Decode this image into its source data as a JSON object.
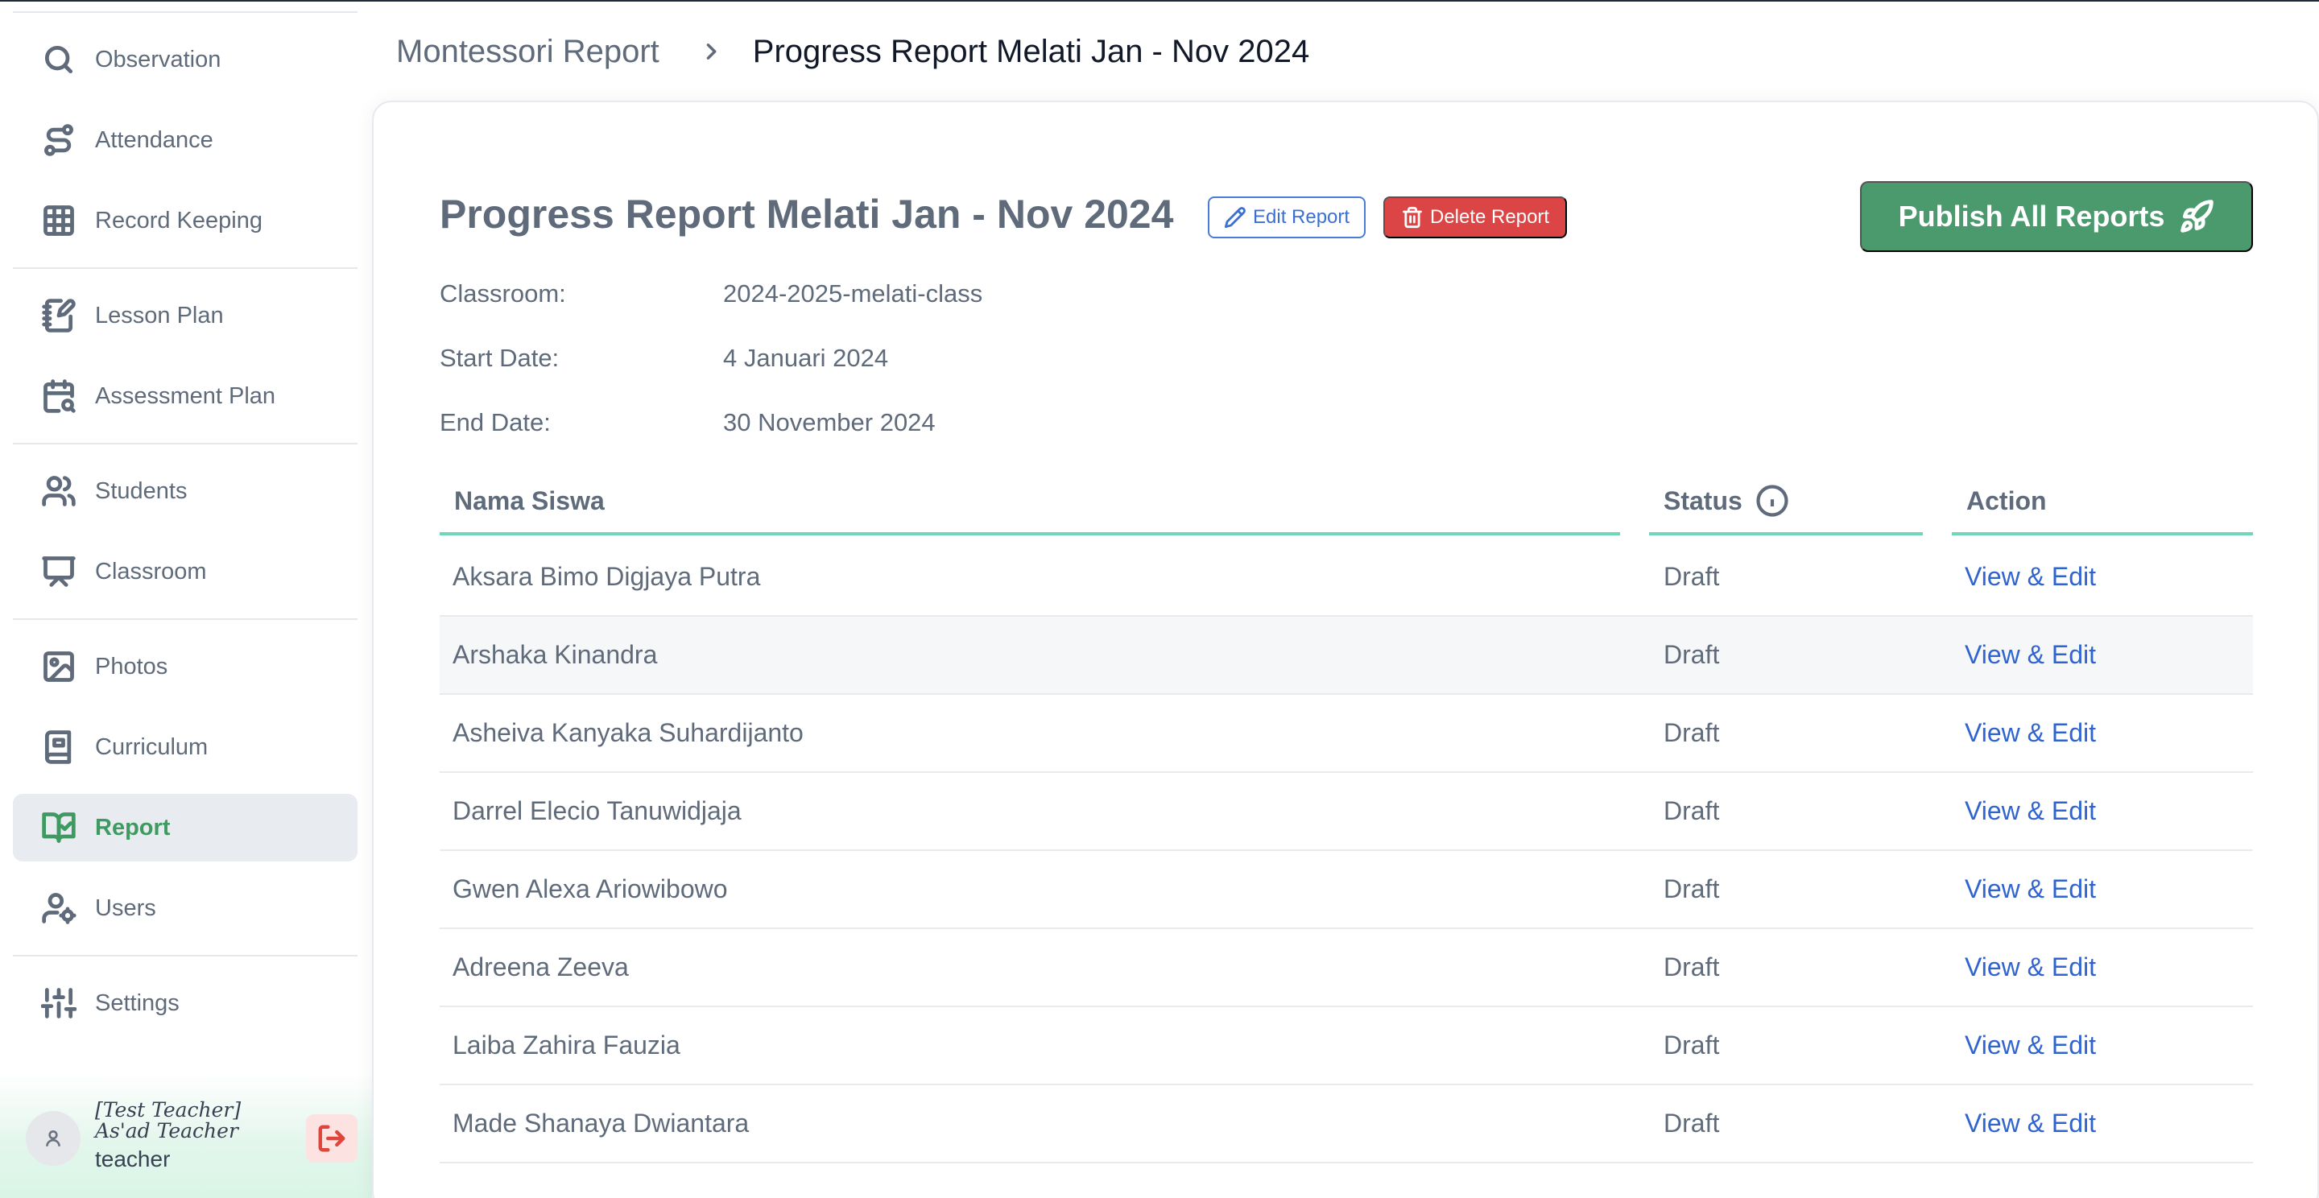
{
  "sidebar": {
    "items": [
      {
        "label": "Observation",
        "icon": "search-icon"
      },
      {
        "label": "Attendance",
        "icon": "route-icon"
      },
      {
        "label": "Record Keeping",
        "icon": "grid-icon"
      },
      {
        "label": "Lesson Plan",
        "icon": "notebook-pen-icon"
      },
      {
        "label": "Assessment Plan",
        "icon": "calendar-search-icon"
      },
      {
        "label": "Students",
        "icon": "users-icon"
      },
      {
        "label": "Classroom",
        "icon": "presentation-icon"
      },
      {
        "label": "Photos",
        "icon": "image-icon"
      },
      {
        "label": "Curriculum",
        "icon": "book-icon"
      },
      {
        "label": "Report",
        "icon": "book-check-icon"
      },
      {
        "label": "Users",
        "icon": "user-cog-icon"
      },
      {
        "label": "Settings",
        "icon": "sliders-icon"
      }
    ],
    "active": "Report",
    "user": {
      "name": "[Test Teacher] As'ad Teacher",
      "role": "teacher"
    }
  },
  "breadcrumb": {
    "root": "Montessori Report",
    "current": "Progress Report Melati Jan - Nov 2024"
  },
  "report": {
    "title": "Progress Report Melati Jan - Nov 2024",
    "edit_label": "Edit Report",
    "delete_label": "Delete Report",
    "publish_label": "Publish All Reports",
    "classroom_label": "Classroom:",
    "classroom_value": "2024-2025-melati-class",
    "start_label": "Start Date:",
    "start_value": "4 Januari 2024",
    "end_label": "End Date:",
    "end_value": "30 November 2024"
  },
  "table": {
    "columns": [
      "Nama Siswa",
      "Status",
      "Action"
    ],
    "rows": [
      {
        "name": "Aksara Bimo Digjaya Putra",
        "status": "Draft",
        "action": "View & Edit"
      },
      {
        "name": "Arshaka Kinandra",
        "status": "Draft",
        "action": "View & Edit"
      },
      {
        "name": "Asheiva Kanyaka Suhardijanto",
        "status": "Draft",
        "action": "View & Edit"
      },
      {
        "name": "Darrel Elecio Tanuwidjaja",
        "status": "Draft",
        "action": "View & Edit"
      },
      {
        "name": "Gwen Alexa Ariowibowo",
        "status": "Draft",
        "action": "View & Edit"
      },
      {
        "name": "Adreena Zeeva",
        "status": "Draft",
        "action": "View & Edit"
      },
      {
        "name": "Laiba Zahira Fauzia",
        "status": "Draft",
        "action": "View & Edit"
      },
      {
        "name": "Made Shanaya Dwiantara",
        "status": "Draft",
        "action": "View & Edit"
      }
    ]
  },
  "colors": {
    "accent": "#4a9a6e",
    "active_nav": "#3f9a61",
    "link": "#2f64d0",
    "danger": "#dc4545",
    "table_header_line": "#6dd7b7"
  }
}
